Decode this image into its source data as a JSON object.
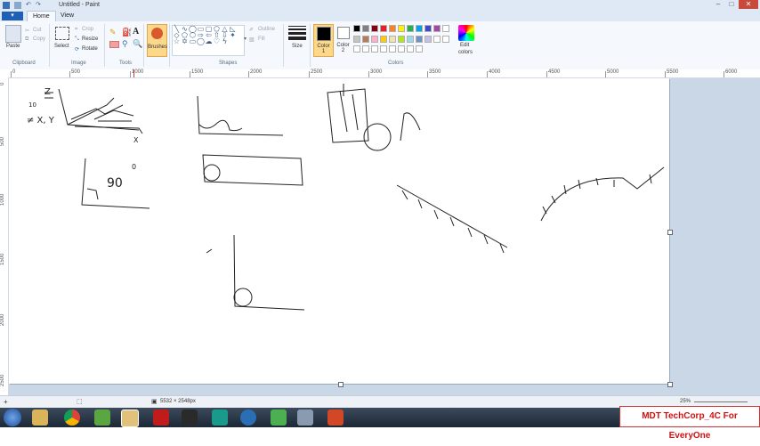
{
  "window": {
    "title": "Untitled - Paint",
    "min": "–",
    "max": "□",
    "close": "✕"
  },
  "file_button": "▾",
  "tabs": [
    {
      "label": "Home"
    },
    {
      "label": "View"
    }
  ],
  "ribbon": {
    "clipboard": {
      "paste": "Paste",
      "cut": "Cut",
      "copy": "Copy",
      "label": "Clipboard"
    },
    "image": {
      "select": "Select",
      "crop": "Crop",
      "resize": "Resize",
      "rotate": "Rotate",
      "label": "Image"
    },
    "tools": {
      "label": "Tools",
      "text_tool": "A"
    },
    "brushes": {
      "label": "Brushes"
    },
    "shapes": {
      "label": "Shapes",
      "outline": "Outline",
      "fill": "Fill"
    },
    "size": {
      "label": "Size"
    },
    "color1": {
      "label": "Color",
      "sub": "1",
      "value": "#000000"
    },
    "color2": {
      "label": "Color",
      "sub": "2",
      "value": "#ffffff"
    },
    "colors": {
      "label": "Colors",
      "palette": [
        "#000000",
        "#7f7f7f",
        "#880015",
        "#ed1c24",
        "#ff7f27",
        "#fff200",
        "#22b14c",
        "#00a2e8",
        "#3f48cc",
        "#a349a4",
        "#ffffff",
        "#c3c3c3",
        "#b97a57",
        "#ffaec9",
        "#ffc90e",
        "#efe4b0",
        "#b5e61d",
        "#99d9ea",
        "#7092be",
        "#c8bfe7",
        "#ffffff",
        "#ffffff",
        "#ffffff",
        "#ffffff",
        "#ffffff",
        "#ffffff",
        "#ffffff",
        "#ffffff",
        "#ffffff",
        "#ffffff"
      ]
    },
    "edit_colors": {
      "line1": "Edit",
      "line2": "colors"
    }
  },
  "ruler": {
    "h": [
      {
        "label": "0"
      },
      {
        "label": "500"
      },
      {
        "label": "1000"
      },
      {
        "label": "1500"
      },
      {
        "label": "2000"
      },
      {
        "label": "2500"
      },
      {
        "label": "3000"
      },
      {
        "label": "3500"
      },
      {
        "label": "4000"
      },
      {
        "label": "4500"
      },
      {
        "label": "5000"
      },
      {
        "label": "5500"
      },
      {
        "label": "6000"
      }
    ],
    "v": [
      {
        "label": "0"
      },
      {
        "label": "500"
      },
      {
        "label": "1000"
      },
      {
        "label": "1500"
      },
      {
        "label": "2000"
      },
      {
        "label": "2500"
      }
    ]
  },
  "sketch": {
    "text_z": "Z",
    "text_90": "90",
    "text_deg": "0",
    "text_x": "≠ X, Y",
    "text_xaxis": "X",
    "text_10": "10"
  },
  "status": {
    "size": "5532 × 2548px",
    "zoom": "25%"
  },
  "banner": {
    "text": "MDT TechCorp_4C For EveryOne"
  }
}
